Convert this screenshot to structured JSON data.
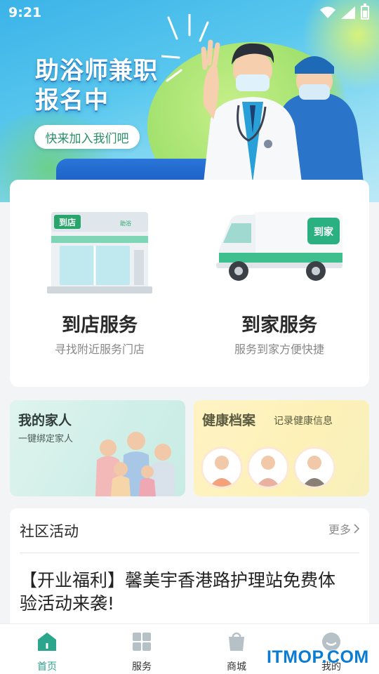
{
  "status_bar": {
    "time": "9:21"
  },
  "banner": {
    "title_line1": "助浴师兼职",
    "title_line2": "报名中",
    "cta": "快来加入我们吧"
  },
  "services": [
    {
      "title": "到店服务",
      "subtitle": "寻找附近服务门店",
      "illus_label": "到店",
      "illus_sub": "助浴"
    },
    {
      "title": "到家服务",
      "subtitle": "服务到家方便快捷",
      "illus_label": "到家"
    }
  ],
  "family": {
    "title": "我的家人",
    "subtitle": "一键绑定家人"
  },
  "health": {
    "title": "健康档案",
    "subtitle": "记录健康信息"
  },
  "community": {
    "title": "社区活动",
    "more": "更多",
    "article": "【开业福利】馨美宇香港路护理站免费体验活动来袭!"
  },
  "tabs": [
    {
      "label": "首页",
      "icon": "home-icon",
      "active": true
    },
    {
      "label": "服务",
      "icon": "grid-icon",
      "active": false
    },
    {
      "label": "商城",
      "icon": "shopping-bag-icon",
      "active": false
    },
    {
      "label": "我的",
      "icon": "profile-icon",
      "active": false
    }
  ],
  "watermark": "ITMOP.COM",
  "colors": {
    "accent": "#2ca58d",
    "banner_blue": "#3bb3e8",
    "health_bg": "#fff3c4",
    "family_bg": "#dff4ee"
  }
}
